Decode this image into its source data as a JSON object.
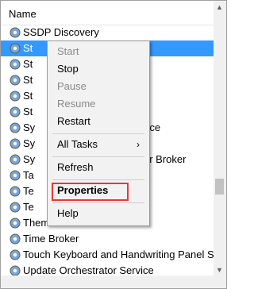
{
  "header": {
    "column": "Name"
  },
  "services": [
    "SSDP Discovery",
    "St",
    "St",
    "St",
    "St",
    "St",
    "Sy",
    "Sy",
    "Sy",
    "Ta",
    "Te",
    "Te",
    "Themes",
    "Time Broker",
    "Touch Keyboard and Handwriting Panel Servic",
    "Update Orchestrator Service"
  ],
  "peek_suffixes": {
    "row6": "vice",
    "row8": "or Broker"
  },
  "context_menu": {
    "items": [
      {
        "label": "Start",
        "disabled": true
      },
      {
        "label": "Stop",
        "disabled": false
      },
      {
        "label": "Pause",
        "disabled": true
      },
      {
        "label": "Resume",
        "disabled": true
      },
      {
        "label": "Restart",
        "disabled": false
      },
      {
        "label": "All Tasks",
        "disabled": false,
        "submenu_glyph": "›"
      },
      {
        "label": "Refresh",
        "disabled": false
      },
      {
        "label": "Properties",
        "disabled": false
      },
      {
        "label": "Help",
        "disabled": false
      }
    ]
  },
  "colors": {
    "selection": "#3399ff",
    "highlight_box": "#e53935"
  },
  "icons": {
    "service": "gear-icon",
    "scroll_up": "scroll-up-arrow-icon"
  }
}
